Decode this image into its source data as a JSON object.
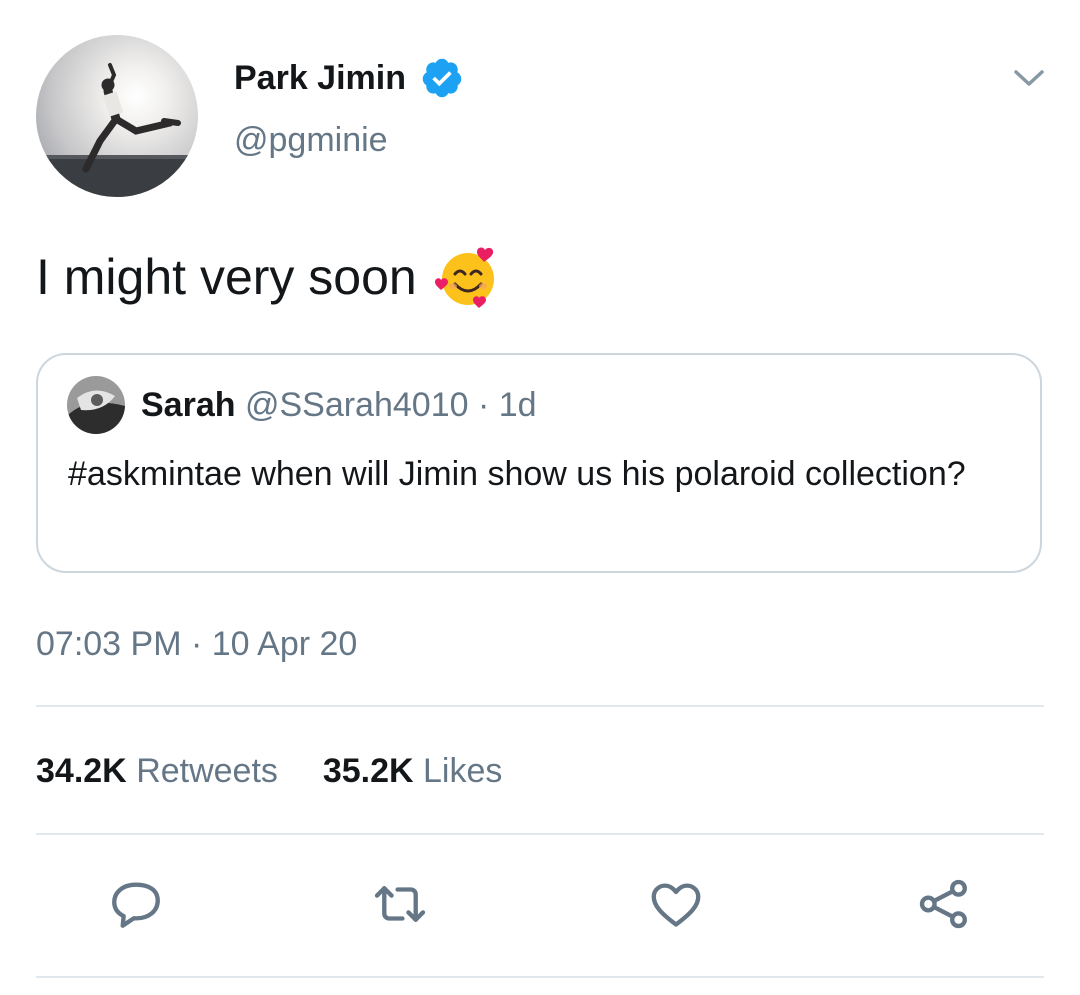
{
  "author": {
    "display_name": "Park Jimin",
    "handle": "@pgminie",
    "verified": true,
    "avatar_icon": "jumping-person-avatar"
  },
  "tweet": {
    "text": "I might very soon",
    "emoji_icon": "smiling-face-with-hearts-emoji"
  },
  "quoted_tweet": {
    "name": "Sarah",
    "handle": "@SSarah4010",
    "separator": "·",
    "age": "1d",
    "text": "#askmintae when will Jimin show us his polaroid collection?"
  },
  "timestamp": {
    "time": "07:03 PM",
    "separator": "·",
    "date": "10 Apr 20"
  },
  "stats": {
    "retweets_count": "34.2K",
    "retweets_label": "Retweets",
    "likes_count": "35.2K",
    "likes_label": "Likes"
  },
  "actions": [
    "reply-icon",
    "retweet-icon",
    "like-icon",
    "share-icon"
  ],
  "colors": {
    "primary_text": "#14171a",
    "secondary_text": "#657786",
    "verified_blue": "#1da1f2",
    "border": "#ccd6dd",
    "divider": "#e1e8ed",
    "icon_gray": "#657786"
  }
}
